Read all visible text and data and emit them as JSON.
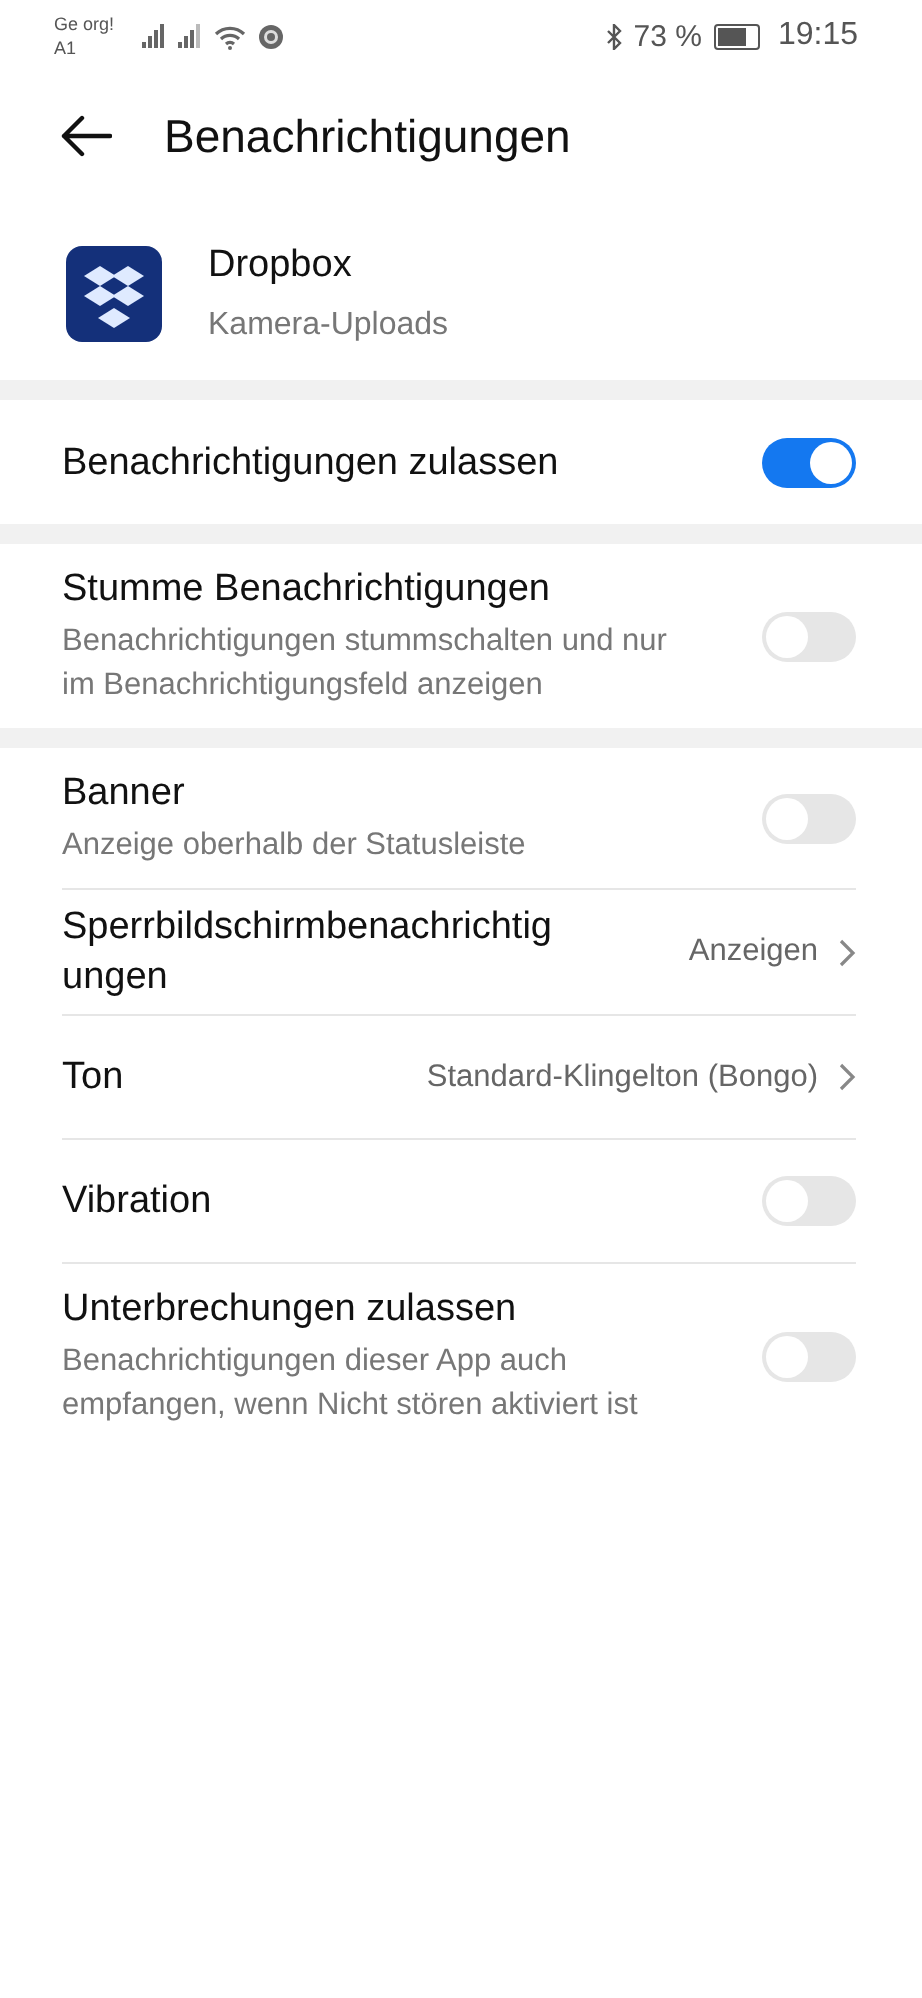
{
  "status_bar": {
    "carrier": [
      "Ge org!",
      "A1"
    ],
    "battery": "73 %",
    "time": "19:15"
  },
  "header": {
    "title": "Benachrichtigungen"
  },
  "app": {
    "name": "Dropbox",
    "channel": "Kamera-Uploads"
  },
  "sections": [
    {
      "rows": [
        {
          "kind": "toggle",
          "title": "Benachrichtigungen zulassen",
          "on": true
        }
      ]
    },
    {
      "rows": [
        {
          "kind": "toggle",
          "title": "Stumme Benachrichtigungen",
          "subtitle": "Benachrichtigungen stummschalten und nur im Benachrichtigungsfeld anzeigen",
          "on": false
        }
      ]
    },
    {
      "rows": [
        {
          "kind": "toggle",
          "title": "Banner",
          "subtitle": "Anzeige oberhalb der Statusleiste",
          "on": false
        },
        {
          "kind": "value",
          "title": "Sperrbildschirmbenachrichtigungen",
          "value": "Anzeigen"
        },
        {
          "kind": "value",
          "title": "Ton",
          "value": "Standard-Klingelton (Bongo)"
        },
        {
          "kind": "toggle",
          "title": "Vibration",
          "on": false
        },
        {
          "kind": "toggle",
          "title": "Unterbrechungen zulassen",
          "subtitle": "Benachrichtigungen dieser App auch empfangen, wenn Nicht stören aktiviert ist",
          "on": false
        }
      ]
    }
  ]
}
